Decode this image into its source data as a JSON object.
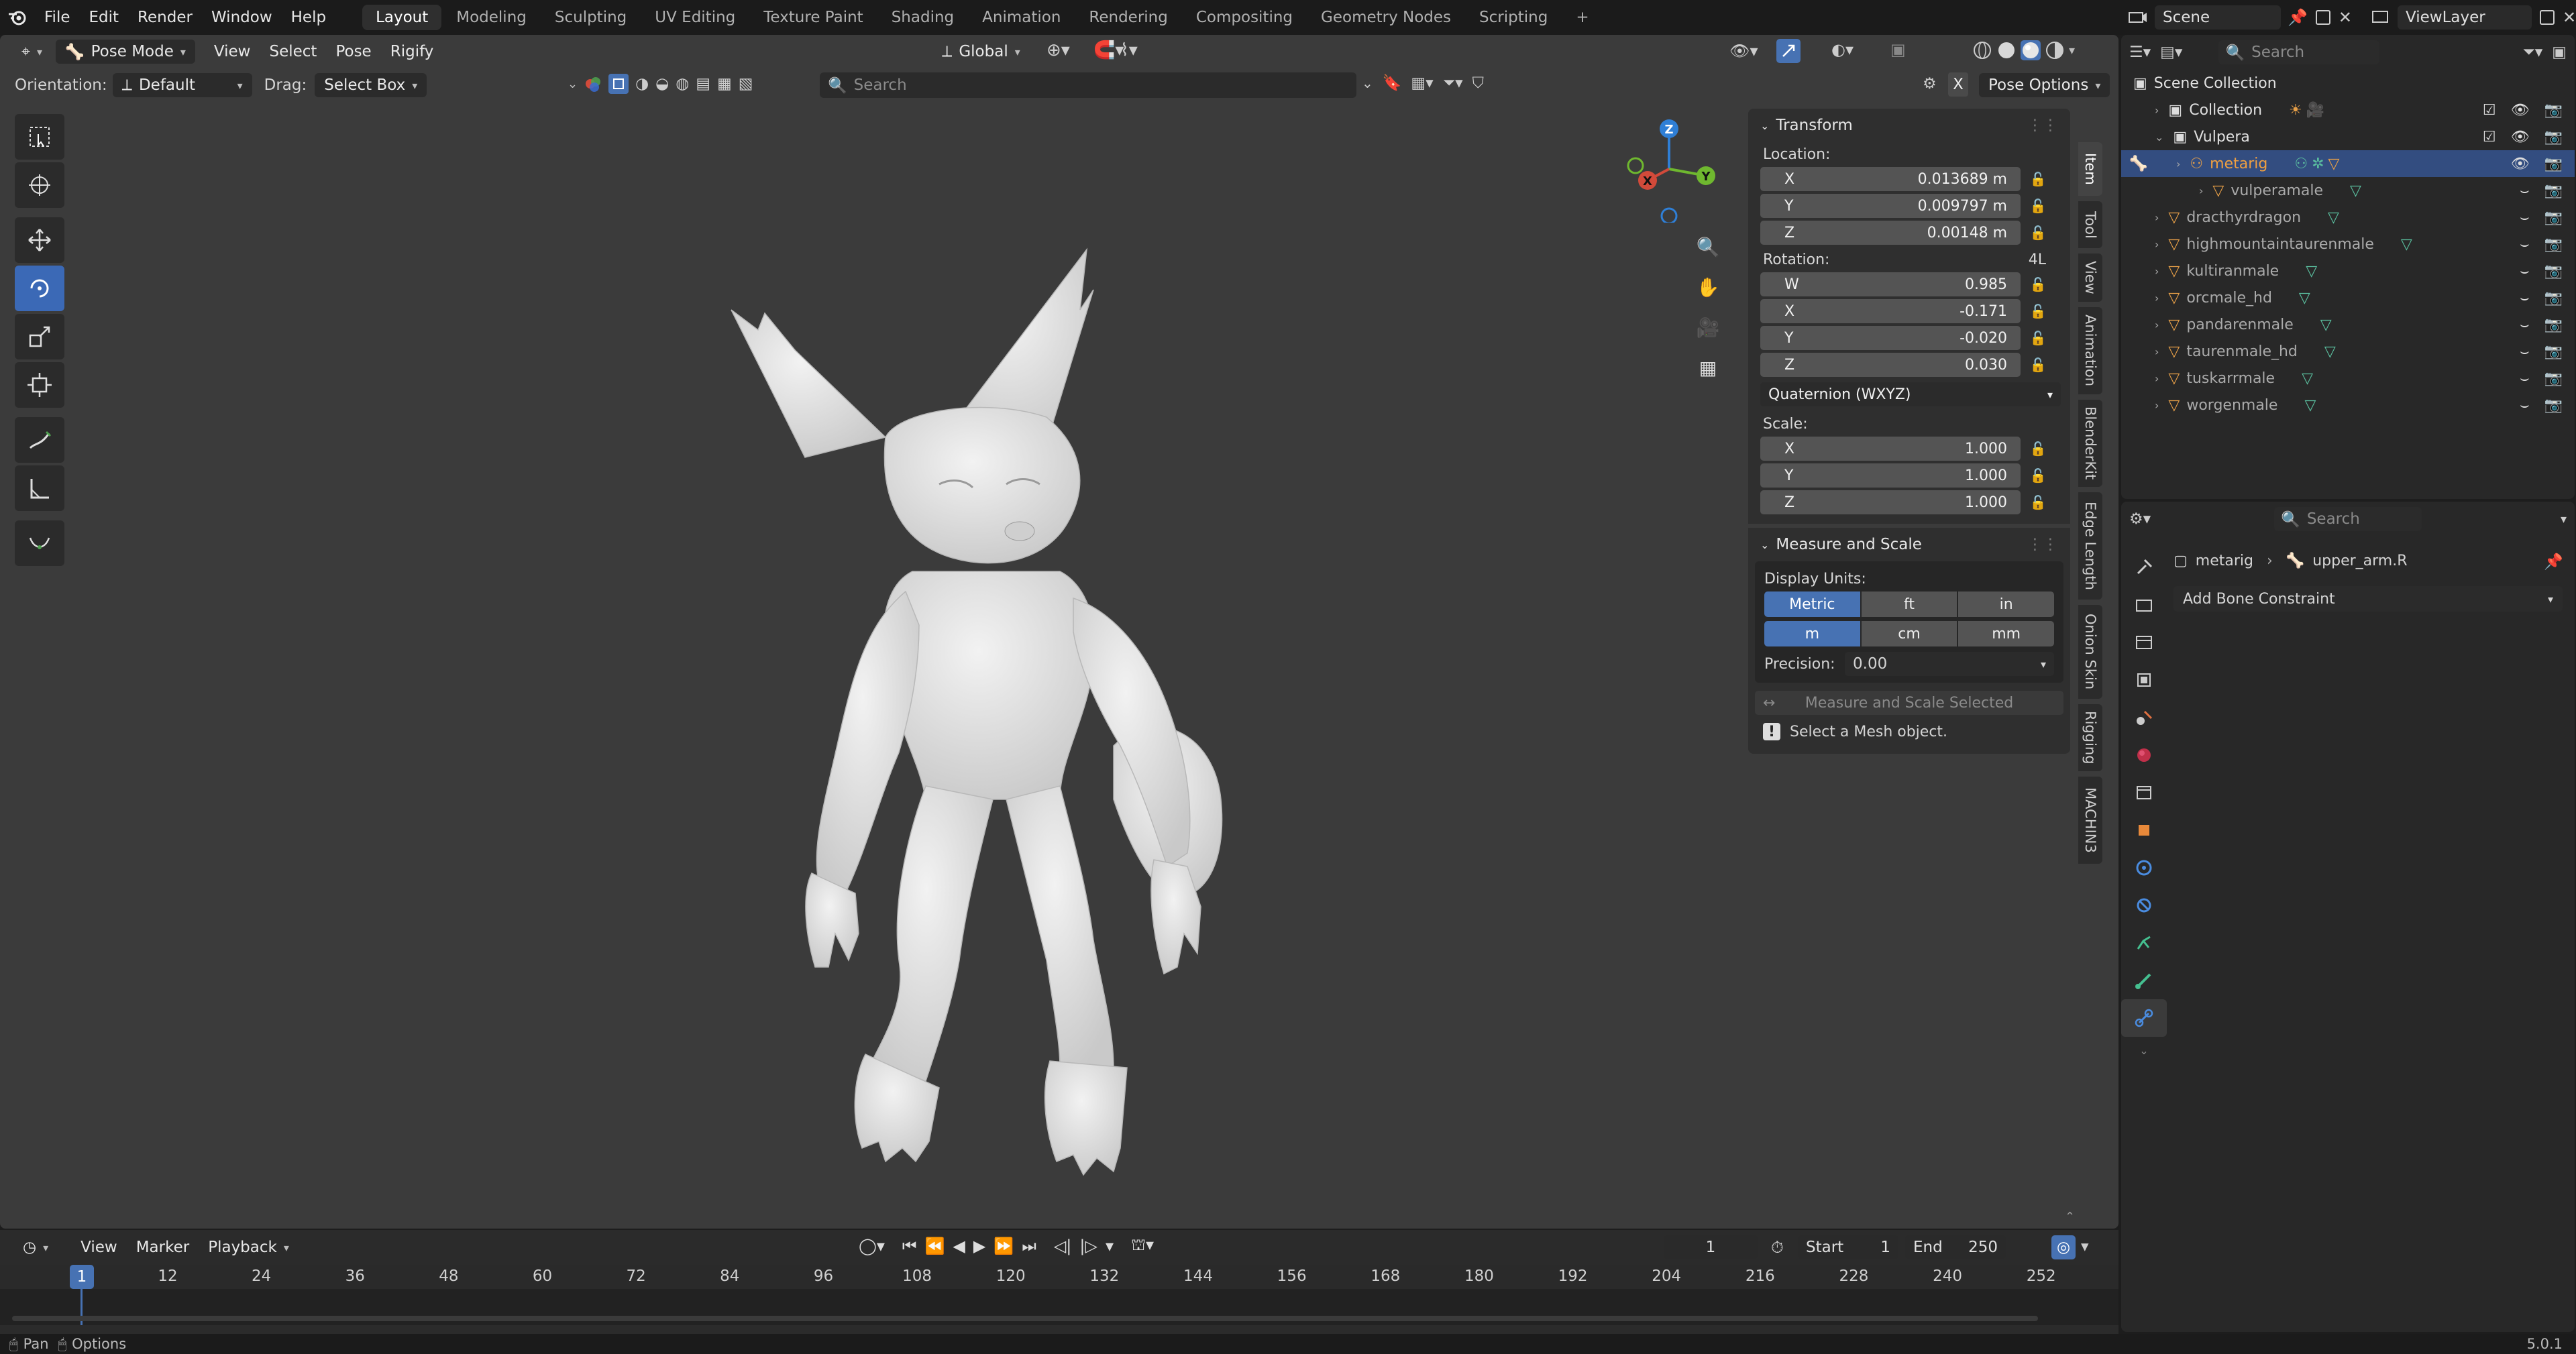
{
  "topbar": {
    "menus": [
      "File",
      "Edit",
      "Render",
      "Window",
      "Help"
    ],
    "workspaces": [
      "Layout",
      "Modeling",
      "Sculpting",
      "UV Editing",
      "Texture Paint",
      "Shading",
      "Animation",
      "Rendering",
      "Compositing",
      "Geometry Nodes",
      "Scripting"
    ],
    "active_workspace": "Layout",
    "add_label": "+",
    "scene_value": "Scene",
    "viewlayer_value": "ViewLayer"
  },
  "viewport": {
    "mode_value": "Pose Mode",
    "menus": [
      "View",
      "Select",
      "Pose",
      "Rigify"
    ],
    "transform_orientation": "Global",
    "orientation_label": "Orientation:",
    "orientation_value": "Default",
    "drag_label": "Drag:",
    "drag_value": "Select Box",
    "search_placeholder": "Search",
    "x_label": "X",
    "pose_options_label": "Pose Options"
  },
  "gizmo": {
    "z": "Z",
    "y": "Y",
    "x": "X"
  },
  "npanel": {
    "transform_title": "Transform",
    "location_label": "Location:",
    "location": [
      {
        "axis": "X",
        "value": "0.013689 m"
      },
      {
        "axis": "Y",
        "value": "0.009797 m"
      },
      {
        "axis": "Z",
        "value": "0.00148 m"
      }
    ],
    "rotation_label": "Rotation:",
    "rotation_extra": "4L",
    "rotation": [
      {
        "axis": "W",
        "value": "0.985"
      },
      {
        "axis": "X",
        "value": "-0.171"
      },
      {
        "axis": "Y",
        "value": "-0.020"
      },
      {
        "axis": "Z",
        "value": "0.030"
      }
    ],
    "rotation_mode": "Quaternion (WXYZ)",
    "scale_label": "Scale:",
    "scale": [
      {
        "axis": "X",
        "value": "1.000"
      },
      {
        "axis": "Y",
        "value": "1.000"
      },
      {
        "axis": "Z",
        "value": "1.000"
      }
    ],
    "measure_title": "Measure and Scale",
    "display_units_label": "Display Units:",
    "units_systems": [
      "Metric",
      "ft",
      "in"
    ],
    "units_lengths": [
      "m",
      "cm",
      "mm"
    ],
    "precision_label": "Precision:",
    "precision_value": "0.00",
    "measure_button": "Measure and Scale Selected",
    "info_text": "Select a Mesh object."
  },
  "vtabs": [
    "Item",
    "Tool",
    "View",
    "Animation",
    "BlenderKit",
    "Edge Length",
    "Onion Skin",
    "Rigging",
    "MACHIN3"
  ],
  "timeline": {
    "menus": [
      "View",
      "Marker",
      "Playback"
    ],
    "current_frame": "1",
    "start_label": "Start",
    "start_value": "1",
    "end_label": "End",
    "end_value": "250",
    "ticks": [
      "1",
      "12",
      "24",
      "36",
      "48",
      "60",
      "72",
      "84",
      "96",
      "108",
      "120",
      "132",
      "144",
      "156",
      "168",
      "180",
      "192",
      "204",
      "216",
      "228",
      "240",
      "252"
    ]
  },
  "statusbar": {
    "pan": "Pan",
    "options": "Options",
    "version": "5.0.1"
  },
  "outliner": {
    "search_placeholder": "Search",
    "rows": [
      {
        "name": "Scene Collection",
        "level": 0
      },
      {
        "name": "Collection",
        "level": 1
      },
      {
        "name": "Vulpera",
        "level": 1
      },
      {
        "name": "metarig",
        "level": 2,
        "selected": true
      },
      {
        "name": "vulperamale",
        "level": 3
      },
      {
        "name": "dracthyrdragon",
        "level": 1
      },
      {
        "name": "highmountaintaurenmale",
        "level": 1
      },
      {
        "name": "kultiranmale",
        "level": 1
      },
      {
        "name": "orcmale_hd",
        "level": 1
      },
      {
        "name": "pandarenmale",
        "level": 1
      },
      {
        "name": "taurenmale_hd",
        "level": 1
      },
      {
        "name": "tuskarrmale",
        "level": 1
      },
      {
        "name": "worgenmale",
        "level": 1
      }
    ]
  },
  "properties": {
    "search_placeholder": "Search",
    "breadcrumb_object": "metarig",
    "breadcrumb_bone": "upper_arm.R",
    "add_constraint": "Add Bone Constraint"
  },
  "colors": {
    "accent": "#4772b3",
    "selected_row": "#334d80",
    "viewport_bg": "#3b3b3b",
    "mesh": "#e2e2e2"
  }
}
